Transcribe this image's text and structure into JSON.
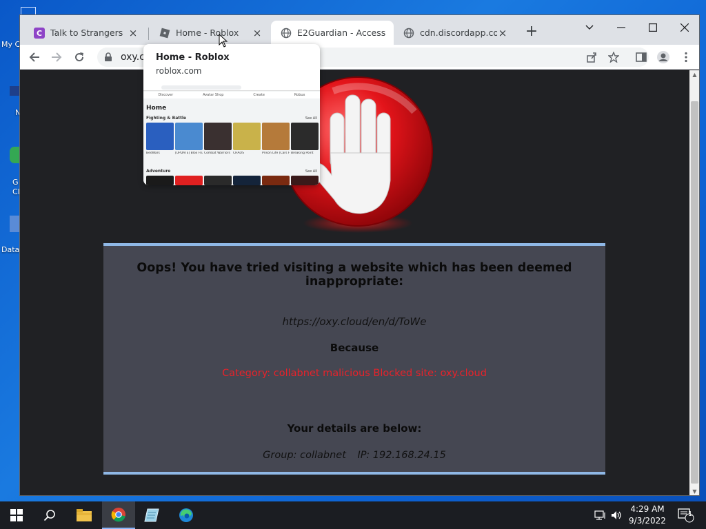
{
  "desktop": {
    "labels": [
      "My C",
      "N",
      "G",
      "Cl",
      "Data"
    ]
  },
  "browser": {
    "tabs": [
      {
        "title": "Talk to Strangers",
        "close": "×"
      },
      {
        "title": "Home - Roblox",
        "close": "×"
      },
      {
        "title": "E2Guardian - Access",
        "close": "×"
      },
      {
        "title": "cdn.discordapp.com",
        "close": "×"
      }
    ],
    "new_tab": "+",
    "address": "oxy.cl",
    "hovercard": {
      "title": "Home - Roblox",
      "domain": "roblox.com",
      "preview": {
        "nav_tabs": [
          "Discover",
          "Avatar Shop",
          "Create",
          "Robux"
        ],
        "home": "Home",
        "section1": "Fighting & Battle",
        "see_all": "See All",
        "games": [
          "BedWars",
          "[UPDATE] Blox Fruits",
          "Combat Warriors",
          "CHAOS",
          "Prison Life (Cars Fixed!)",
          "Breaking Point"
        ],
        "section2": "Adventure"
      }
    }
  },
  "page": {
    "headline": "Oops! You have tried visiting a website which has been deemed inappropriate:",
    "url": "https://oxy.cloud/en/d/ToWe",
    "because": "Because",
    "reason": "Category: collabnet malicious   Blocked site: oxy.cloud",
    "details_heading": "Your details are below:",
    "group": "Group: collabnet",
    "ip": "IP: 192.168.24.15"
  },
  "taskbar": {
    "time": "4:29 AM",
    "date": "9/3/2022",
    "notification_count": "1"
  },
  "colors": {
    "notice_bg": "#454752",
    "notice_border": "#8fb8e6",
    "reason_red": "#e8222a",
    "page_bg": "#202124"
  }
}
